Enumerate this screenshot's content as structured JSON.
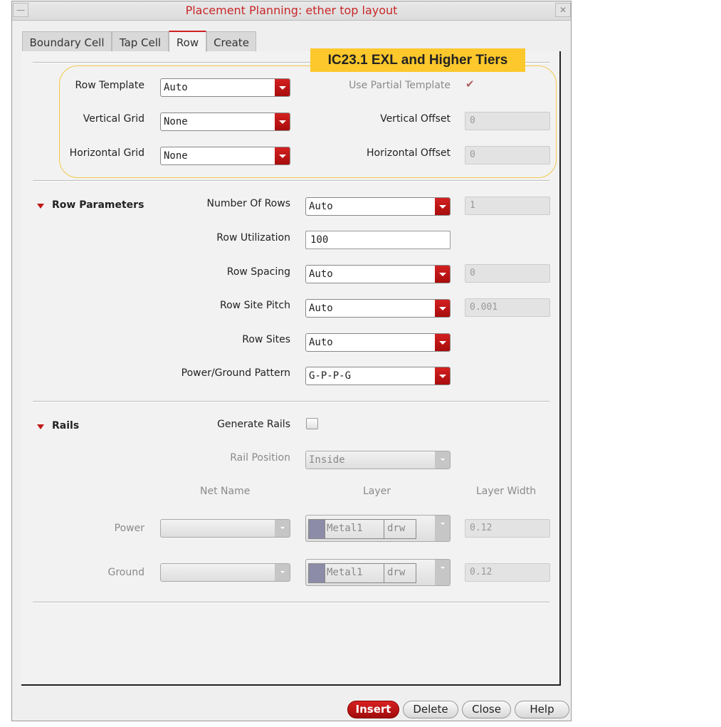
{
  "window": {
    "title": "Placement Planning: ether top layout"
  },
  "tabs": [
    {
      "label": "Boundary Cell"
    },
    {
      "label": "Tap Cell"
    },
    {
      "label": "Row"
    },
    {
      "label": "Create"
    }
  ],
  "badge": {
    "text": "IC23.1 EXL and Higher Tiers",
    "color": "#fcc82c"
  },
  "template": {
    "row_template": {
      "label": "Row Template",
      "value": "Auto"
    },
    "vertical_grid": {
      "label": "Vertical Grid",
      "value": "None"
    },
    "horizontal_grid": {
      "label": "Horizontal Grid",
      "value": "None"
    },
    "use_partial": {
      "label": "Use Partial Template",
      "checked": true
    },
    "vertical_offset": {
      "label": "Vertical Offset",
      "value": "0"
    },
    "horizontal_offset": {
      "label": "Horizontal Offset",
      "value": "0"
    }
  },
  "row_parameters": {
    "title": "Row Parameters",
    "number_of_rows": {
      "label": "Number Of Rows",
      "value": "Auto",
      "field": "1"
    },
    "row_utilization": {
      "label": "Row Utilization",
      "value": "100"
    },
    "row_spacing": {
      "label": "Row Spacing",
      "value": "Auto",
      "field": "0"
    },
    "row_site_pitch": {
      "label": "Row Site Pitch",
      "value": "Auto",
      "field": "0.001"
    },
    "row_sites": {
      "label": "Row Sites",
      "value": "Auto"
    },
    "pg_pattern": {
      "label": "Power/Ground Pattern",
      "value": "G-P-P-G"
    }
  },
  "rails": {
    "title": "Rails",
    "generate": {
      "label": "Generate Rails",
      "checked": false
    },
    "rail_position": {
      "label": "Rail Position",
      "value": "Inside"
    },
    "headers": {
      "net_name": "Net Name",
      "layer": "Layer",
      "layer_width": "Layer Width"
    },
    "power": {
      "label": "Power",
      "net": "",
      "layer": "Metal1",
      "purpose": "drw",
      "width": "0.12"
    },
    "ground": {
      "label": "Ground",
      "net": "",
      "layer": "Metal1",
      "purpose": "drw",
      "width": "0.12"
    }
  },
  "buttons": {
    "insert": "Insert",
    "delete": "Delete",
    "close": "Close",
    "help": "Help"
  }
}
